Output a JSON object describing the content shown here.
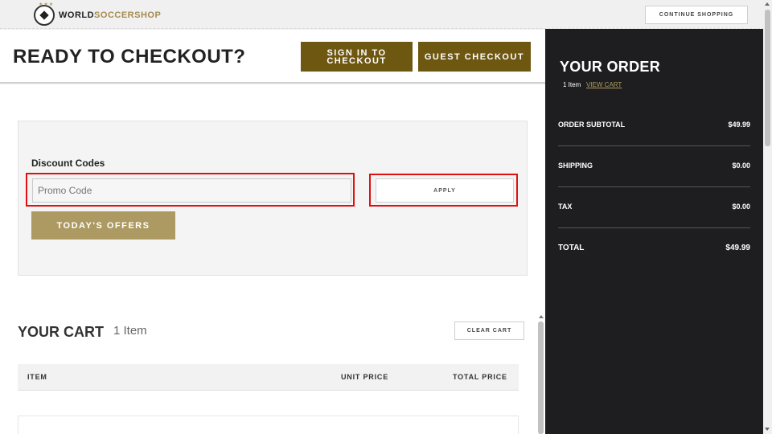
{
  "header": {
    "brand_primary": "WORLD",
    "brand_accent": "SOCCERSHOP",
    "logo_icon": "soccer-ball-icon",
    "continue_label": "CONTINUE SHOPPING"
  },
  "checkout": {
    "title": "READY TO CHECKOUT?",
    "sign_in_label": "SIGN IN TO CHECKOUT",
    "guest_label": "GUEST CHECKOUT"
  },
  "discount": {
    "label": "Discount Codes",
    "promo_placeholder": "Promo Code",
    "promo_value": "",
    "apply_label": "APPLY",
    "offers_label": "TODAY'S OFFERS"
  },
  "cart": {
    "title": "YOUR CART",
    "count": "1 Item",
    "clear_label": "CLEAR CART",
    "columns": [
      "ITEM",
      "UNIT PRICE",
      "TOTAL PRICE"
    ]
  },
  "order": {
    "title": "YOUR ORDER",
    "items": "1 Item",
    "view_cart": "VIEW CART",
    "rows": [
      {
        "label": "ORDER SUBTOTAL",
        "value": "$49.99"
      },
      {
        "label": "SHIPPING",
        "value": "$0.00"
      },
      {
        "label": "TAX",
        "value": "$0.00"
      },
      {
        "label": "TOTAL",
        "value": "$49.99"
      }
    ]
  },
  "colors": {
    "gold_dark": "#6e5711",
    "gold_light": "#ac9a62",
    "highlight_red": "#e01010",
    "panel_dark": "#1e1e20"
  }
}
